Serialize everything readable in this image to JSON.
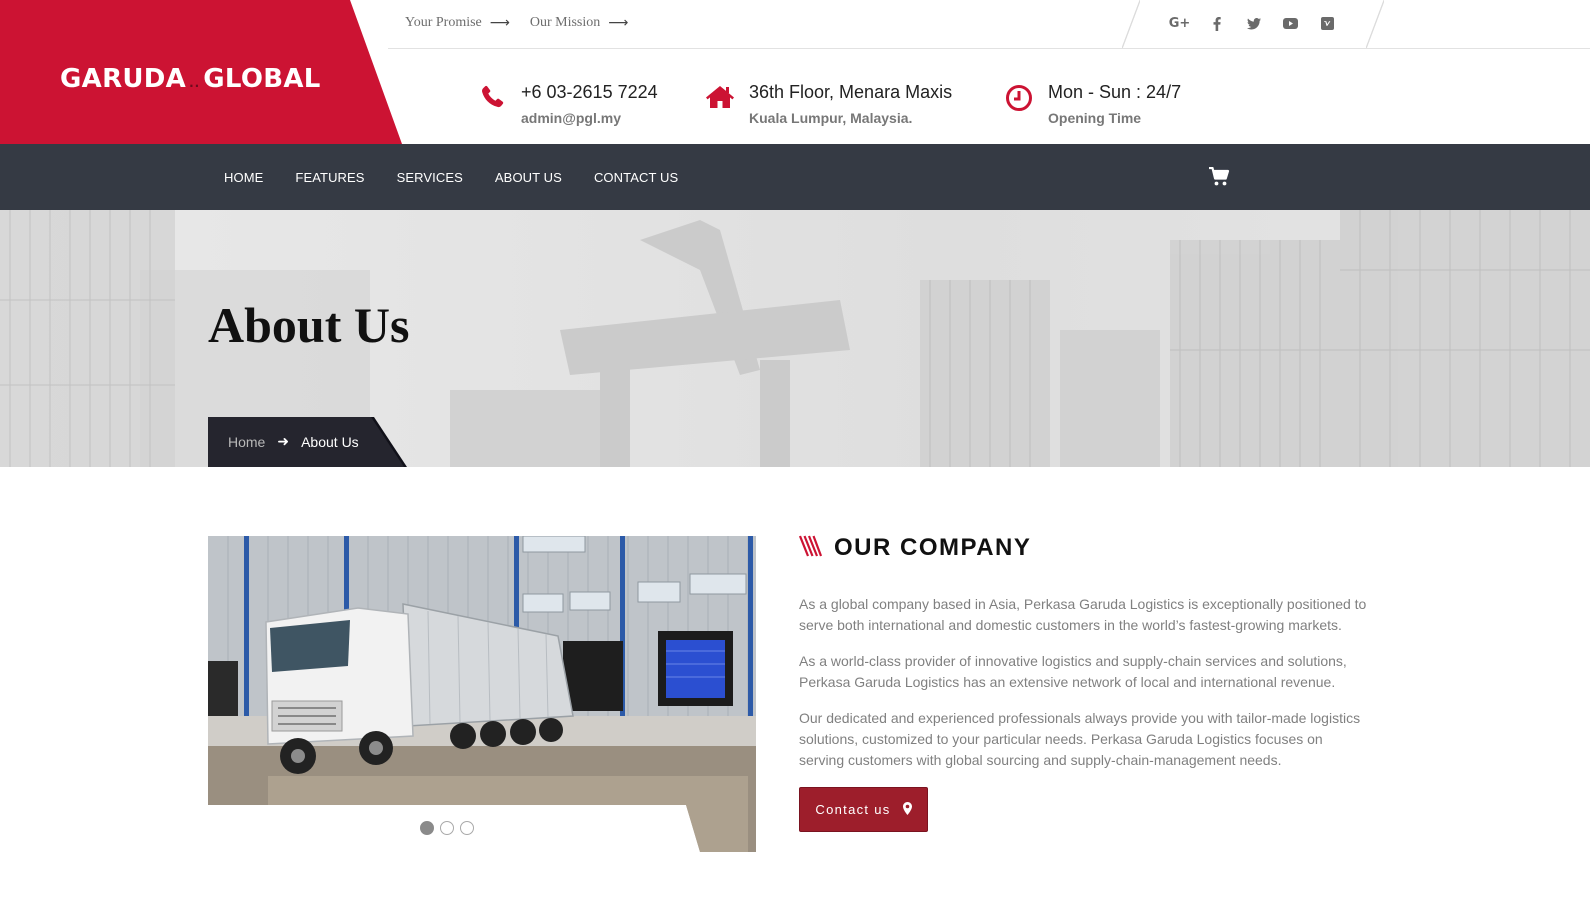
{
  "brand": {
    "logo_left": "GARUDA",
    "logo_dots": "..",
    "logo_right": "GLOBAL",
    "accent_color": "#cc1333",
    "nav_bg": "#353a44",
    "button_color": "#9d1e2b"
  },
  "top_links": [
    {
      "label": "Your Promise",
      "icon": "long-arrow-right-icon"
    },
    {
      "label": "Our Mission",
      "icon": "long-arrow-right-icon"
    }
  ],
  "social": [
    "google-plus-icon",
    "facebook-icon",
    "twitter-icon",
    "youtube-icon",
    "vimeo-icon"
  ],
  "contact_info": [
    {
      "icon": "phone-icon",
      "main": "+6 03-2615 7224",
      "sub": "admin@pgl.my"
    },
    {
      "icon": "home-icon",
      "main": "36th Floor, Menara Maxis",
      "sub": "Kuala Lumpur, Malaysia."
    },
    {
      "icon": "clock-icon",
      "main": "Mon - Sun : 24/7",
      "sub": "Opening Time"
    }
  ],
  "nav": {
    "items": [
      "HOME",
      "FEATURES",
      "SERVICES",
      "ABOUT US",
      "CONTACT US"
    ],
    "cart_icon": "shopping-cart-icon"
  },
  "banner": {
    "title": "About Us",
    "breadcrumb": {
      "home": "Home",
      "separator_icon": "arrow-right-icon",
      "current": "About Us"
    }
  },
  "slider": {
    "image": "white truck parked at warehouse loading docks",
    "dots_total": 3,
    "active_dot": 1
  },
  "company": {
    "title": "OUR COMPANY",
    "title_icon": "red-stripes-icon",
    "paragraphs": [
      "As a global company based in Asia, Perkasa Garuda Logistics is exceptionally positioned to serve both international and domestic customers in the world’s fastest-growing markets.",
      "As a world-class provider of innovative logistics and supply-chain services and solutions, Perkasa Garuda Logistics has an extensive network of local and international revenue.",
      "Our dedicated and experienced professionals always provide you with tailor-made logistics solutions, customized to your particular needs. Perkasa Garuda Logistics focuses on serving customers with global sourcing and supply-chain-management needs."
    ],
    "button_label": "Contact us",
    "button_icon": "map-marker-icon"
  }
}
